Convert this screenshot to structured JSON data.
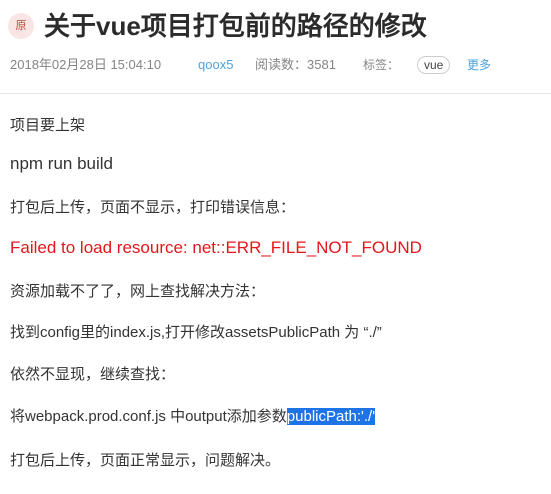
{
  "article": {
    "badge": "原",
    "title": "关于vue项目打包前的路径的修改",
    "meta": {
      "date": "2018年02月28日 15:04:10",
      "author": "qoox5",
      "views_label": "阅读数：3581",
      "tags_label": "标签：",
      "tag": "vue",
      "more": "更多"
    }
  },
  "content": {
    "p1": "项目要上架",
    "p2": "npm run build",
    "p3": "打包后上传，页面不显示，打印错误信息：",
    "p4": "Failed to load resource: net::ERR_FILE_NOT_FOUND",
    "p5": "资源加载不了了，网上查找解决方法：",
    "p6": "找到config里的index.js,打开修改assetsPublicPath 为 “./”",
    "p7": "依然不显现，继续查找：",
    "p8_prefix": "将webpack.prod.conf.js 中output添加参数",
    "p8_highlight": "publicPath:'./'",
    "p9": "打包后上传，页面正常显示，问题解决。"
  },
  "colors": {
    "error": "#e4161b",
    "link": "#4ea1db",
    "selection": "#1e74e6"
  }
}
